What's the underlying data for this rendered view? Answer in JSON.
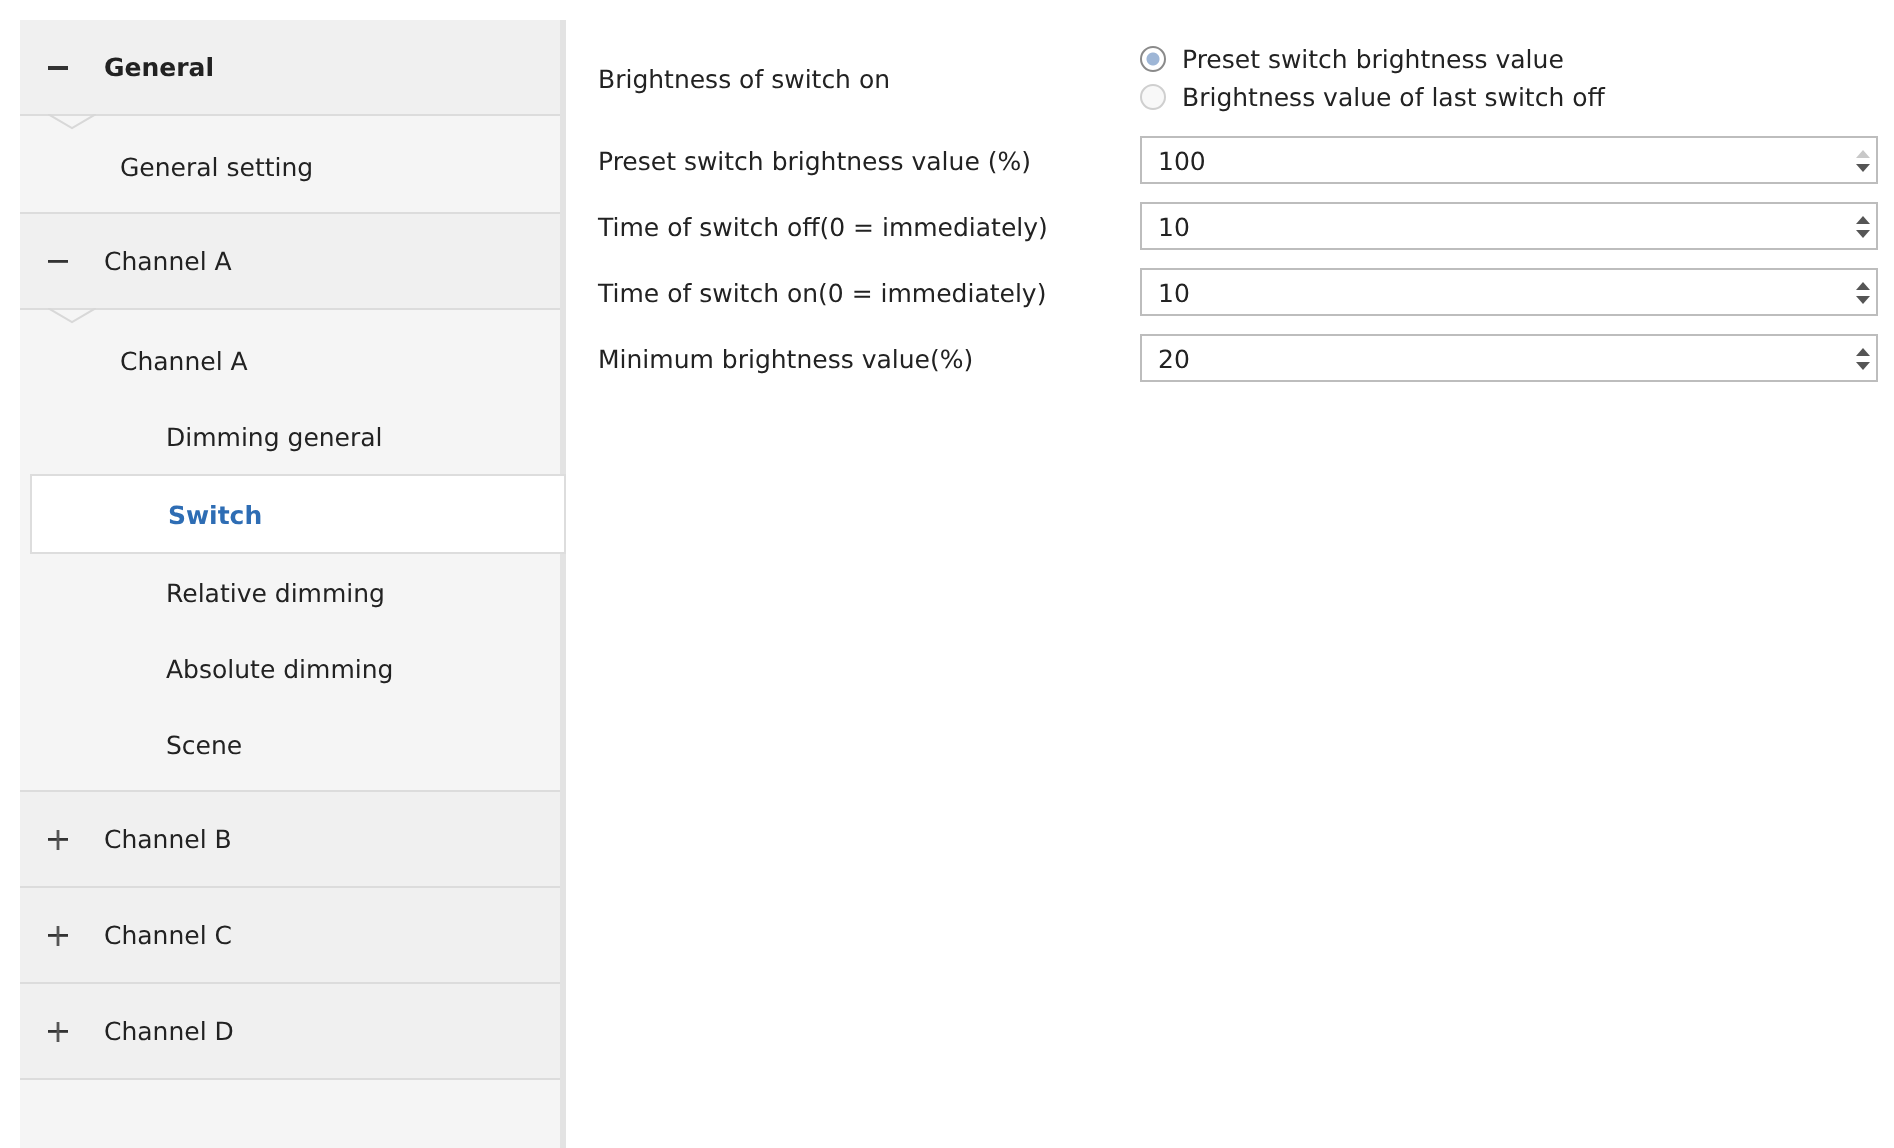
{
  "sidebar": {
    "sections": [
      {
        "label": "General",
        "expanded": true,
        "emphasized": true,
        "children": [
          {
            "label": "General setting",
            "selected": false
          }
        ]
      },
      {
        "label": "Channel A",
        "expanded": true,
        "emphasized": false,
        "children": [
          {
            "label": "Channel A",
            "selected": false,
            "children": [
              {
                "label": "Dimming general",
                "selected": false
              },
              {
                "label": "Switch",
                "selected": true
              },
              {
                "label": "Relative dimming",
                "selected": false
              },
              {
                "label": "Absolute dimming",
                "selected": false
              },
              {
                "label": "Scene",
                "selected": false
              }
            ]
          }
        ]
      },
      {
        "label": "Channel B",
        "expanded": false,
        "emphasized": false
      },
      {
        "label": "Channel C",
        "expanded": false,
        "emphasized": false
      },
      {
        "label": "Channel D",
        "expanded": false,
        "emphasized": false
      }
    ]
  },
  "parameters": [
    {
      "kind": "radio",
      "label": "Brightness of switch on",
      "options": [
        {
          "label": "Preset switch brightness value",
          "selected": true
        },
        {
          "label": "Brightness value of last switch off",
          "selected": false
        }
      ]
    },
    {
      "kind": "number",
      "label": "Preset switch brightness value (%)",
      "value": "100",
      "at_max": true
    },
    {
      "kind": "number",
      "label": "Time of switch off(0 = immediately)",
      "value": "10",
      "at_max": false
    },
    {
      "kind": "number",
      "label": "Time of switch on(0 = immediately)",
      "value": "10",
      "at_max": false
    },
    {
      "kind": "number",
      "label": "Minimum brightness value(%)",
      "value": "20",
      "at_max": false
    }
  ]
}
